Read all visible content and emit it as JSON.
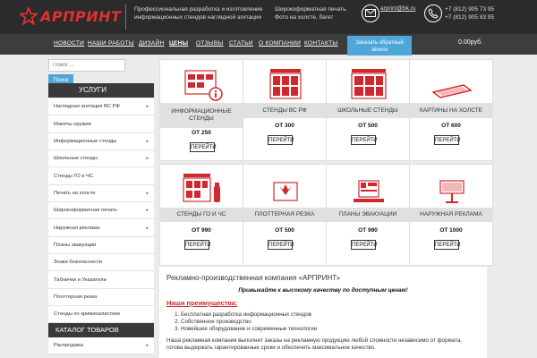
{
  "header": {
    "logo_text": "АРПРИНТ",
    "tagline": "Профессиональная разработка и изготовление информационных стендов наглядной агитации",
    "services": "Широкоформатная печать. Фото на холсте, багет",
    "email": "arprint@bk.ru",
    "phone1": "+7 (812) 905 73 95",
    "phone2": "+7 (812) 905 83 95"
  },
  "nav": {
    "items": [
      "НОВОСТИ",
      "НАШИ РАБОТЫ",
      "ДИЗАЙН",
      "ЦЕНЫ",
      "ОТЗЫВЫ",
      "СТАТЬИ",
      "О КОМПАНИИ",
      "КОНТАКТЫ"
    ],
    "callback_label": "Заказать обратный звонок",
    "cart_total": "0.00руб."
  },
  "sidebar": {
    "search_placeholder": "Поиск ...",
    "search_button": "Поиск",
    "services_header": "УСЛУГИ",
    "items": [
      {
        "label": "Наглядная агитация ВС РФ",
        "arrow": "▸"
      },
      {
        "label": "Макеты оружия",
        "arrow": ""
      },
      {
        "label": "Информационные стенды",
        "arrow": "▸"
      },
      {
        "label": "Школьные стенды",
        "arrow": "▸"
      },
      {
        "label": "Стенды ГО и ЧС",
        "arrow": ""
      },
      {
        "label": "Печать на холсте",
        "arrow": "▸"
      },
      {
        "label": "Широкоформатная печать",
        "arrow": "▸"
      },
      {
        "label": "Наружная реклама",
        "arrow": "▸"
      },
      {
        "label": "Планы эвакуации",
        "arrow": ""
      },
      {
        "label": "Знаки безопасности",
        "arrow": ""
      },
      {
        "label": "Таблички и Указатели",
        "arrow": ""
      },
      {
        "label": "Плоттерная резка",
        "arrow": ""
      },
      {
        "label": "Стенды по криминалистике",
        "arrow": ""
      }
    ],
    "catalog_header": "КАТАЛОГ ТОВАРОВ",
    "catalog_items": [
      {
        "label": "Распродажа",
        "arrow": "▸"
      }
    ]
  },
  "products": [
    {
      "title": "ИНФОРМАЦИОННЫЕ СТЕНДЫ",
      "price": "ОТ 250",
      "button": "ПЕРЕЙТИ",
      "icon": "info-stand-icon"
    },
    {
      "title": "СТЕНДЫ ВС РФ",
      "price": "ОТ 300",
      "button": "ПЕРЕЙТИ",
      "icon": "military-stand-icon"
    },
    {
      "title": "ШКОЛЬНЫЕ СТЕНДЫ",
      "price": "ОТ 500",
      "button": "ПЕРЕЙТИ",
      "icon": "school-stand-icon"
    },
    {
      "title": "КАРТИНЫ НА ХОЛСТЕ",
      "price": "ОТ 600",
      "button": "ПЕРЕЙТИ",
      "icon": "canvas-picture-icon"
    },
    {
      "title": "СТЕНДЫ ГО И ЧС",
      "price": "ОТ 990",
      "button": "ПЕРЕЙТИ",
      "icon": "civil-defense-icon"
    },
    {
      "title": "ПЛОТТЕРНАЯ РЕЗКА",
      "price": "ОТ 500",
      "button": "ПЕРЕЙТИ",
      "icon": "plotter-icon"
    },
    {
      "title": "ПЛАНЫ ЭВАКУАЦИИ",
      "price": "ОТ 990",
      "button": "ПЕРЕЙТИ",
      "icon": "evacuation-plan-icon"
    },
    {
      "title": "НАРУЖНАЯ РЕКЛАМА",
      "price": "ОТ 1000",
      "button": "ПЕРЕЙТИ",
      "icon": "outdoor-ad-icon"
    }
  ],
  "company": {
    "title": "Рекламно-производственная компания «АРПРИНТ»",
    "slogan": "Привыкайте к высокому качеству по доступным ценам!",
    "advantages_title": "Наши преимущества:",
    "advantages": [
      "Бесплатная разработка информационных стендов",
      "Собственное производство",
      "Новейшее оборудование и современные технологии"
    ],
    "description": "Наша рекламная компания выполнит заказы на рекламную продукцию любой сложности независимо от формата, готова выдержать гарантированные сроки и обеспечить максимальное качество."
  },
  "colors": {
    "brand_red": "#e03131",
    "accent_blue": "#4ea7d8",
    "dark_bar": "#2b2b2b"
  }
}
